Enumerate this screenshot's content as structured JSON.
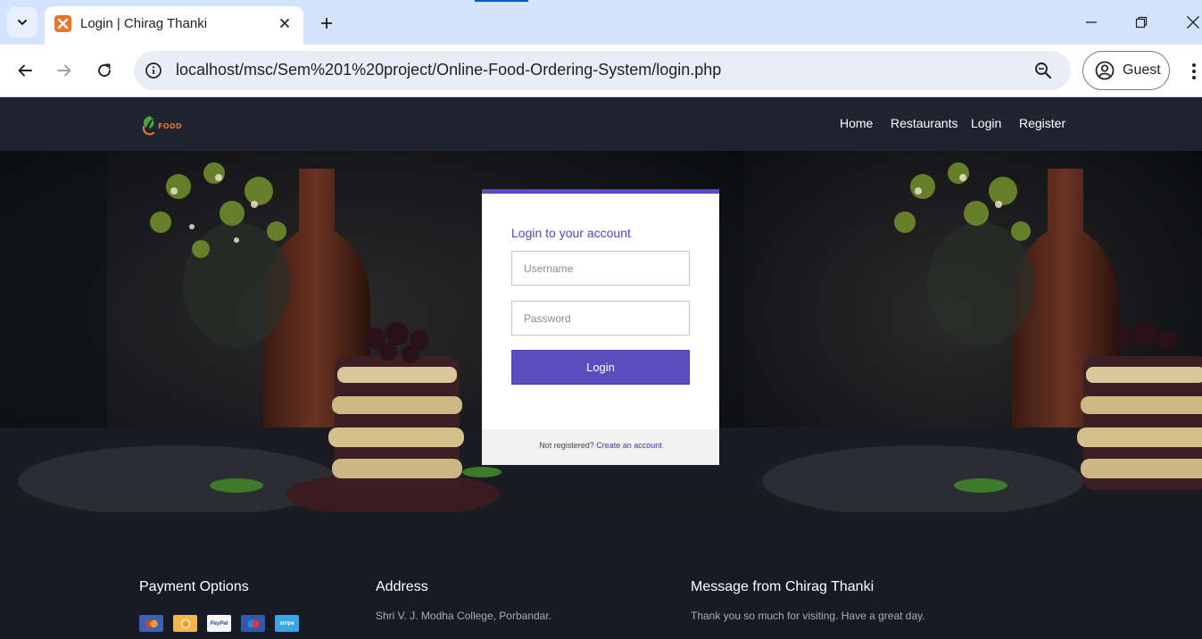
{
  "browser": {
    "tab_title": "Login | Chirag Thanki",
    "url": "localhost/msc/Sem%201%20project/Online-Food-Ordering-System/login.php",
    "profile_label": "Guest",
    "accent_color": "#d3e3fd"
  },
  "site": {
    "logo_text": "FOOD",
    "nav": [
      "Home",
      "Restaurants",
      "Login",
      "Register"
    ],
    "colors": {
      "primary": "#5b4cbf",
      "header_bg": "#1e2531",
      "footer_bg": "#161b26"
    }
  },
  "login": {
    "title": "Login to your account",
    "username_placeholder": "Username",
    "password_placeholder": "Password",
    "button": "Login",
    "footer_text": "Not registered?",
    "footer_link": "Create an account"
  },
  "footer": {
    "payment": {
      "heading": "Payment Options",
      "icons": [
        "mastercard-icon",
        "bitcoin-icon",
        "paypal-icon",
        "maestro-icon",
        "stripe-icon"
      ],
      "paypal_text": "PayPal",
      "stripe_text": "stripe"
    },
    "address": {
      "heading": "Address",
      "text": "Shri V. J. Modha College, Porbandar."
    },
    "message": {
      "heading": "Message from Chirag Thanki",
      "text": "Thank you so much for visiting. Have a great day."
    }
  }
}
